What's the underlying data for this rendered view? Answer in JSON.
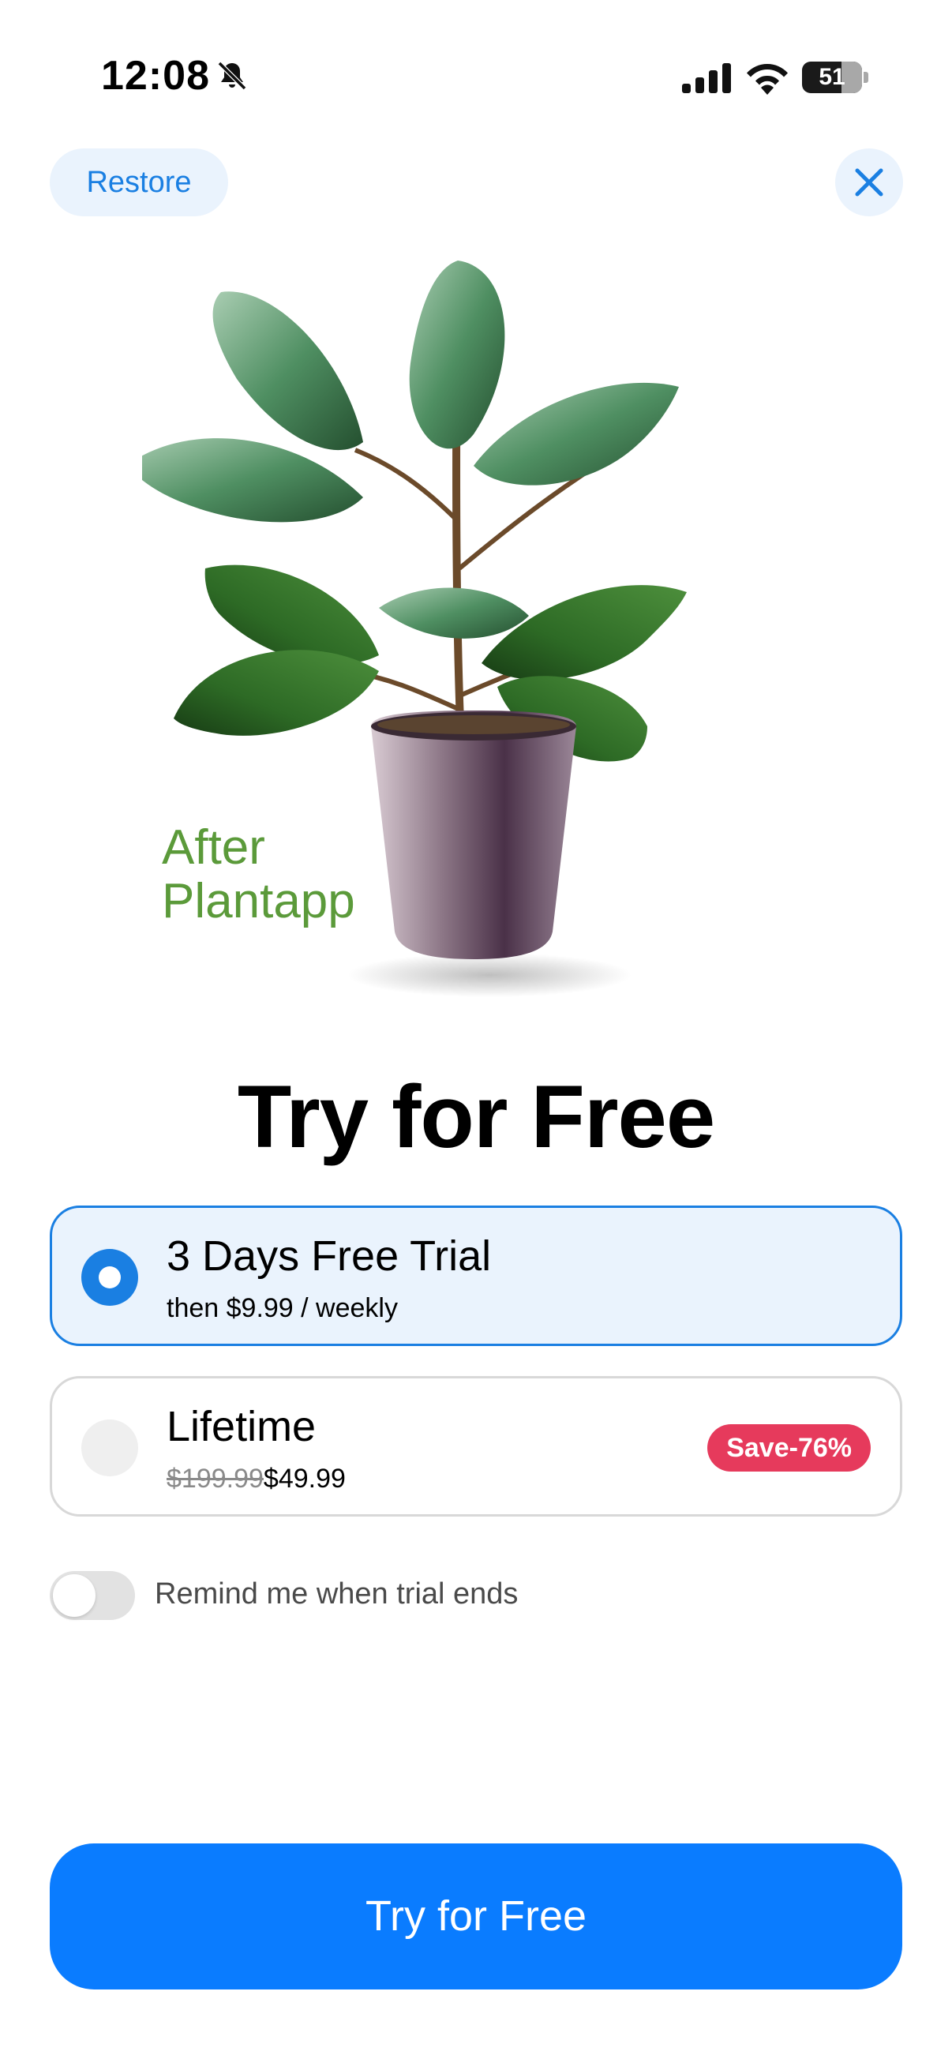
{
  "status_bar": {
    "time": "12:08",
    "battery": "51",
    "icons": [
      "bell-slash-icon",
      "cellular-signal-icon",
      "wifi-icon",
      "battery-icon"
    ]
  },
  "header": {
    "restore_label": "Restore",
    "close_icon": "close-icon"
  },
  "hero": {
    "caption_line1": "After",
    "caption_line2": "Plantapp"
  },
  "title": "Try for Free",
  "plans": [
    {
      "name": "3 Days Free Trial",
      "subtitle": "then $9.99 / weekly",
      "selected": true
    },
    {
      "name": "Lifetime",
      "old_price": "$199.99",
      "price": "$49.99",
      "badge": "Save-76%",
      "selected": false
    }
  ],
  "reminder": {
    "label": "Remind me when trial ends",
    "enabled": false
  },
  "cta_label": "Try for Free",
  "colors": {
    "accent": "#0a7cff",
    "accent_soft": "#eaf3fd",
    "badge": "#e63a5c",
    "caption_green": "#5b9a3a"
  }
}
